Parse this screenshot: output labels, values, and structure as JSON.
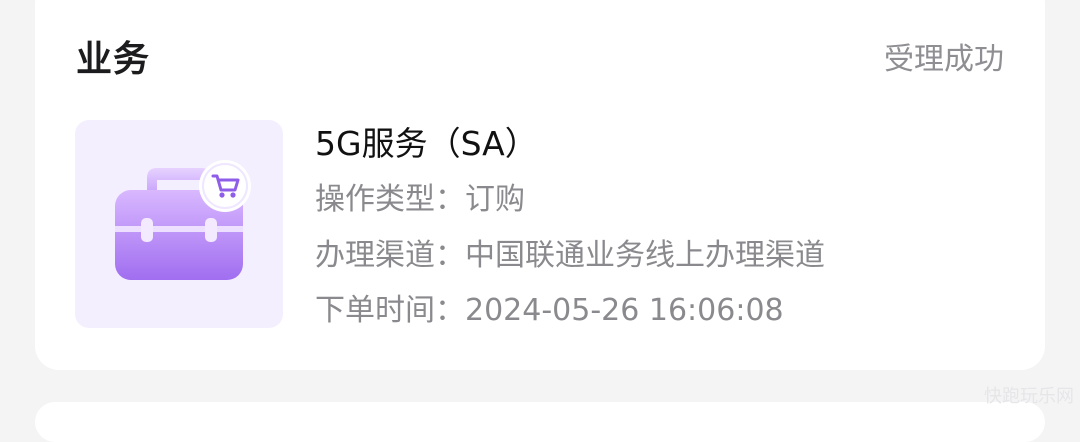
{
  "header": {
    "title": "业务",
    "status": "受理成功"
  },
  "service": {
    "name": "5G服务（SA）",
    "icon": "briefcase-cart-icon",
    "accent_color": "#a878f0",
    "rows": [
      {
        "label": "操作类型：",
        "value": "订购"
      },
      {
        "label": "办理渠道：",
        "value": "中国联通业务线上办理渠道"
      },
      {
        "label": "下单时间：",
        "value": "2024-05-26 16:06:08"
      }
    ]
  },
  "watermark": "快跑玩乐网"
}
